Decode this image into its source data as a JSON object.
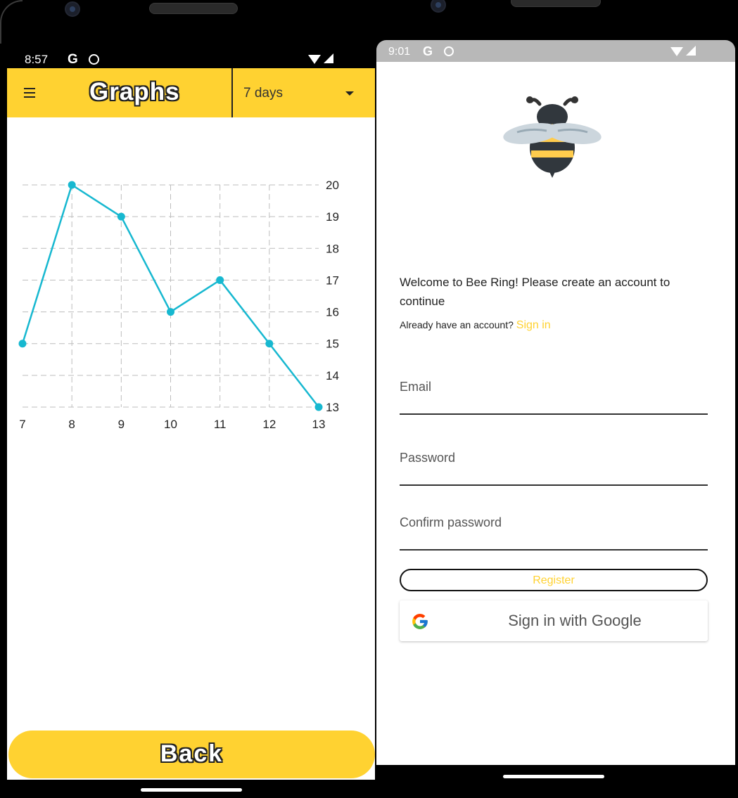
{
  "left_screen": {
    "status_bar": {
      "time": "8:57",
      "g_icon": "G"
    },
    "app_bar": {
      "menu_icon": "hamburger-menu-icon",
      "title": "Graphs",
      "range_select": {
        "selected": "7 days",
        "icon": "caret-down-icon"
      }
    },
    "back_button": {
      "label": "Back"
    },
    "accent_color": "#ffd231"
  },
  "chart_data": {
    "type": "line",
    "x": [
      7,
      8,
      9,
      10,
      11,
      12,
      13
    ],
    "values": [
      15,
      20,
      19,
      16,
      17,
      15,
      13
    ],
    "x_tick_labels": [
      "7",
      "8",
      "9",
      "10",
      "11",
      "12",
      "13"
    ],
    "y_tick_labels": [
      "20",
      "19",
      "18",
      "17",
      "16",
      "15",
      "14",
      "13"
    ],
    "ylim": [
      13,
      20
    ],
    "xlim": [
      7,
      13
    ],
    "title": "",
    "xlabel": "",
    "ylabel": "",
    "grid": true,
    "y_axis_side": "right",
    "line_color": "#17b8d0"
  },
  "right_screen": {
    "status_bar": {
      "time": "9:01",
      "g_icon": "G"
    },
    "logo": "bee-icon",
    "welcome_text": "Welcome to Bee Ring! Please create an account to continue",
    "account_prompt": "Already have an account?",
    "sign_in_link": "Sign in",
    "email_label": "Email",
    "password_label": "Password",
    "confirm_password_label": "Confirm password",
    "register_label": "Register",
    "google_label": "Sign in with Google",
    "accent_color": "#ffd231"
  }
}
